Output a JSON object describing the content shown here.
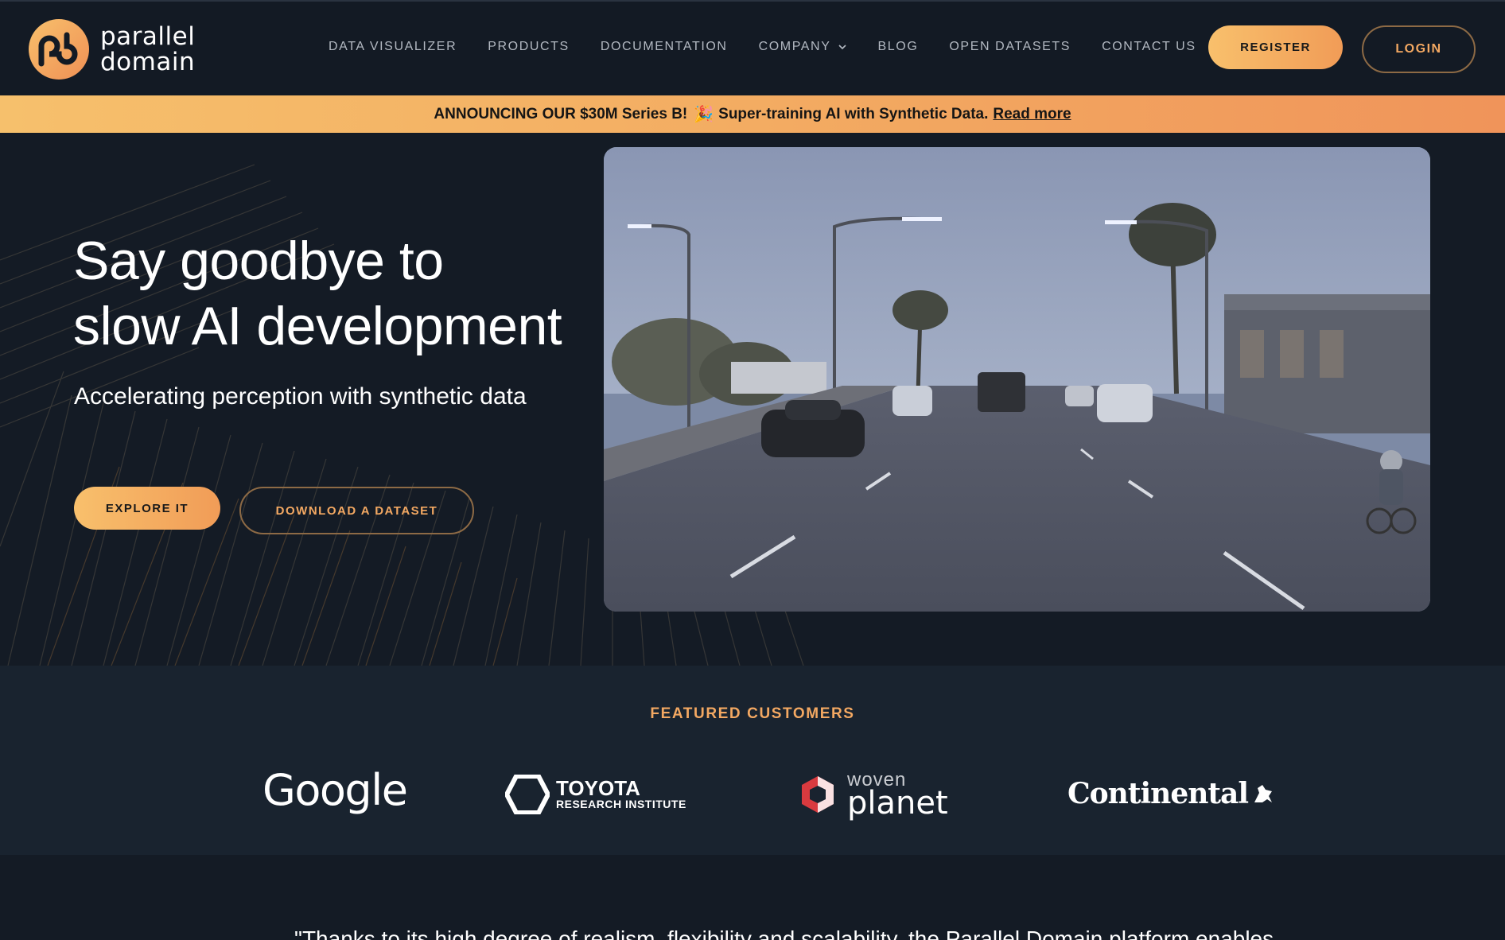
{
  "brand": {
    "line1": "parallel",
    "line2": "domain"
  },
  "nav": {
    "links": [
      "DATA VISUALIZER",
      "PRODUCTS",
      "DOCUMENTATION",
      "COMPANY",
      "BLOG",
      "OPEN DATASETS",
      "CONTACT US"
    ],
    "register_label": "REGISTER",
    "login_label": "LOGIN"
  },
  "banner": {
    "text": "ANNOUNCING OUR $30M Series B!",
    "party": "🎉",
    "text2": "Super-training AI with Synthetic Data.",
    "link": "Read more"
  },
  "hero": {
    "title_line1": "Say goodbye to",
    "title_line2": "slow AI development",
    "subtitle": "Accelerating perception with synthetic data",
    "explore_label": "EXPLORE IT",
    "download_label": "DOWNLOAD A DATASET",
    "image_alt": "synthetic street scene"
  },
  "customers": {
    "title": "FEATURED CUSTOMERS",
    "google": "Google",
    "toyota_line1": "TOYOTA",
    "toyota_line2": "RESEARCH INSTITUTE",
    "woven_line1": "woven",
    "woven_line2": "planet",
    "continental": "Continental"
  },
  "quote": {
    "text": "\"Thanks to its high degree of realism, flexibility and scalability, the Parallel Domain platform enables"
  },
  "colors": {
    "accent": "#f3a862",
    "background": "#141b25",
    "customers_bg": "#19232f"
  }
}
